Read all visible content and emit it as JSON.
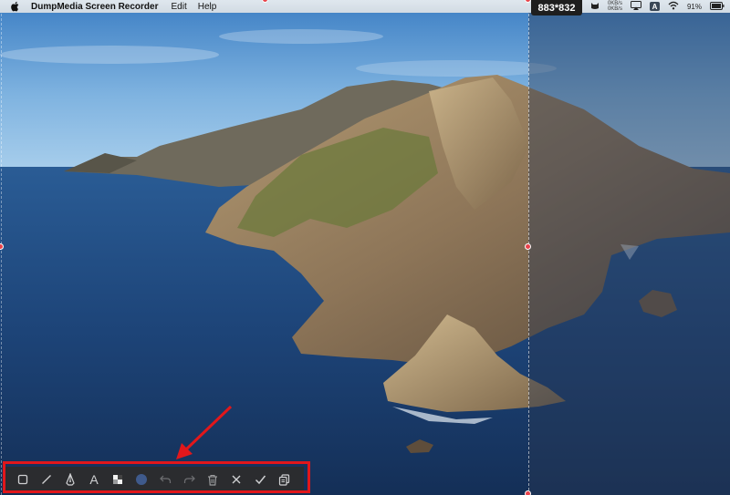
{
  "menubar": {
    "app_name": "DumpMedia Screen Recorder",
    "menu_items": [
      "Edit",
      "Help"
    ],
    "net_up": "0KB/s",
    "net_down": "0KB/s",
    "input_badge": "A",
    "battery": "91%"
  },
  "selection": {
    "size_label": "883*832"
  },
  "toolbar": {
    "tools": [
      {
        "name": "rectangle-tool",
        "icon": "square-icon"
      },
      {
        "name": "line-tool",
        "icon": "line-icon"
      },
      {
        "name": "pen-tool",
        "icon": "pen-icon"
      },
      {
        "name": "text-tool",
        "icon": "text-icon"
      },
      {
        "name": "mosaic-tool",
        "icon": "mosaic-icon"
      },
      {
        "name": "color-picker",
        "icon": "color-dot-icon"
      },
      {
        "name": "undo-button",
        "icon": "undo-icon"
      },
      {
        "name": "redo-button",
        "icon": "redo-icon"
      },
      {
        "name": "delete-button",
        "icon": "trash-icon"
      },
      {
        "name": "cancel-button",
        "icon": "close-icon"
      },
      {
        "name": "confirm-button",
        "icon": "check-icon"
      },
      {
        "name": "copy-button",
        "icon": "copy-icon"
      }
    ],
    "text_tool_glyph": "A",
    "selected_color": "#3f5a8c"
  },
  "colors": {
    "handle": "#e8424a",
    "highlight": "#e1171b",
    "toolbar_bg": "#2b2c2f"
  }
}
